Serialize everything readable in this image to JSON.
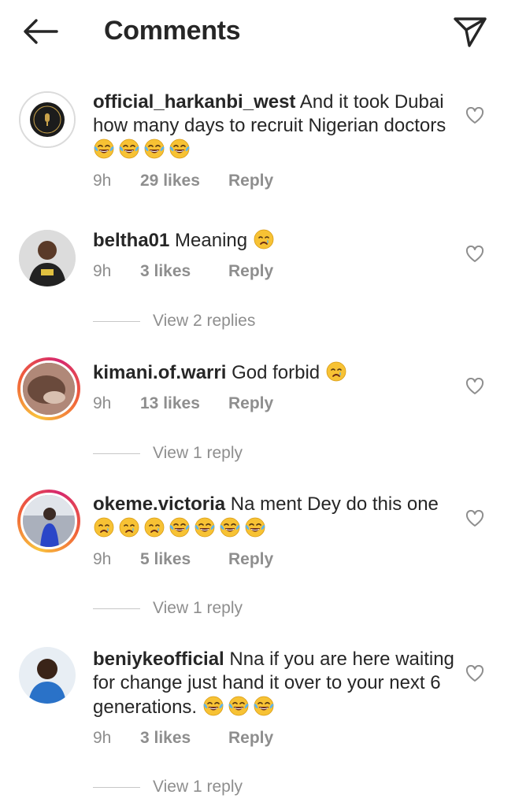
{
  "header": {
    "title": "Comments",
    "back_icon": "arrow-left-icon",
    "send_icon": "paper-plane-icon"
  },
  "comments": [
    {
      "username": "official_harkanbi_west",
      "text": "And it took Dubai how many days to recruit  Nigerian doctors",
      "emojis": [
        "joy",
        "joy",
        "joy",
        "joy"
      ],
      "time": "9h",
      "likes": "29 likes",
      "reply": "Reply",
      "view_replies": ""
    },
    {
      "username": "beltha01",
      "text": "Meaning",
      "emojis": [
        "cry"
      ],
      "time": "9h",
      "likes": "3 likes",
      "reply": "Reply",
      "view_replies": "View 2 replies"
    },
    {
      "username": "kimani.of.warri",
      "text": "God forbid",
      "emojis": [
        "cry"
      ],
      "time": "9h",
      "likes": "13 likes",
      "reply": "Reply",
      "view_replies": "View 1 reply"
    },
    {
      "username": "okeme.victoria",
      "text": "Na ment Dey do this one",
      "emojis": [
        "cry",
        "cry",
        "cry",
        "joy",
        "joy",
        "joy",
        "joy"
      ],
      "time": "9h",
      "likes": "5 likes",
      "reply": "Reply",
      "view_replies": "View 1 reply"
    },
    {
      "username": "beniykeofficial",
      "text": "Nna if you are here waiting for change just hand it over to your next 6 generations.",
      "emojis": [
        "joy",
        "joy",
        "joy"
      ],
      "time": "9h",
      "likes": "3 likes",
      "reply": "Reply",
      "view_replies": "View 1 reply"
    }
  ],
  "colors": {
    "text": "#262626",
    "muted": "#8e8e8e",
    "divider": "#c7c7c7",
    "story_ring": "#d6286e"
  },
  "icons": {
    "like": "heart-outline-icon",
    "joy_emoji": "face-with-tears-of-joy",
    "cry_emoji": "crying-face"
  }
}
